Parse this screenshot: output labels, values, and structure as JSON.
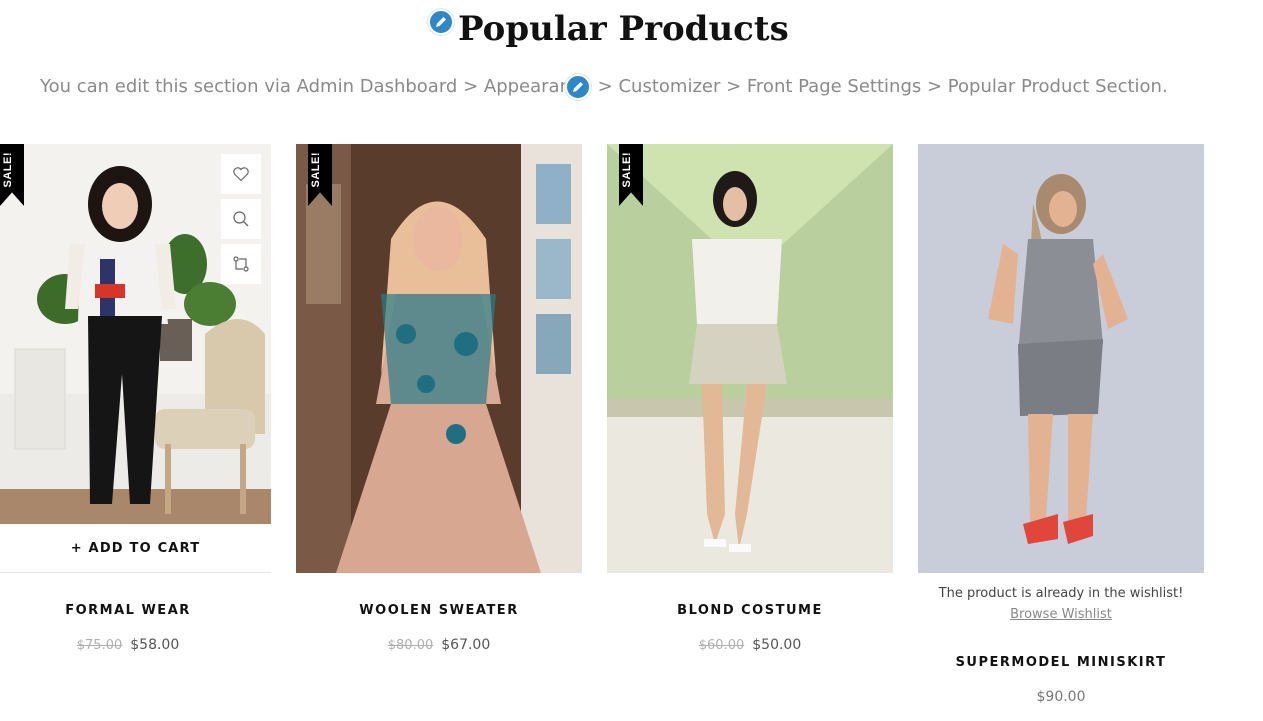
{
  "section": {
    "title": "Popular Products",
    "description": "You can edit this section via Admin Dashboard > Appearance > Customizer > Front Page Settings > Popular Product Section."
  },
  "icons": {
    "edit": "pencil-icon",
    "wishlist": "heart-icon",
    "quick_view": "search-icon",
    "compare": "compare-icon"
  },
  "colors": {
    "edit_badge": "#2f86c8",
    "sale_ribbon": "#000000",
    "price_old": "#b0b0b0"
  },
  "products": [
    {
      "name": "FORMAL WEAR",
      "badge": "SALE!",
      "old_price": "$75.00",
      "price": "$58.00",
      "cta": "+ ADD TO CART"
    },
    {
      "name": "WOOLEN SWEATER",
      "badge": "SALE!",
      "old_price": "$80.00",
      "price": "$67.00"
    },
    {
      "name": "BLOND COSTUME",
      "badge": "SALE!",
      "old_price": "$60.00",
      "price": "$50.00"
    },
    {
      "name": "SUPERMODEL MINISKIRT",
      "price": "$90.00",
      "wishlist_msg": "The product is already in the wishlist!",
      "wishlist_link": "Browse Wishlist"
    }
  ]
}
